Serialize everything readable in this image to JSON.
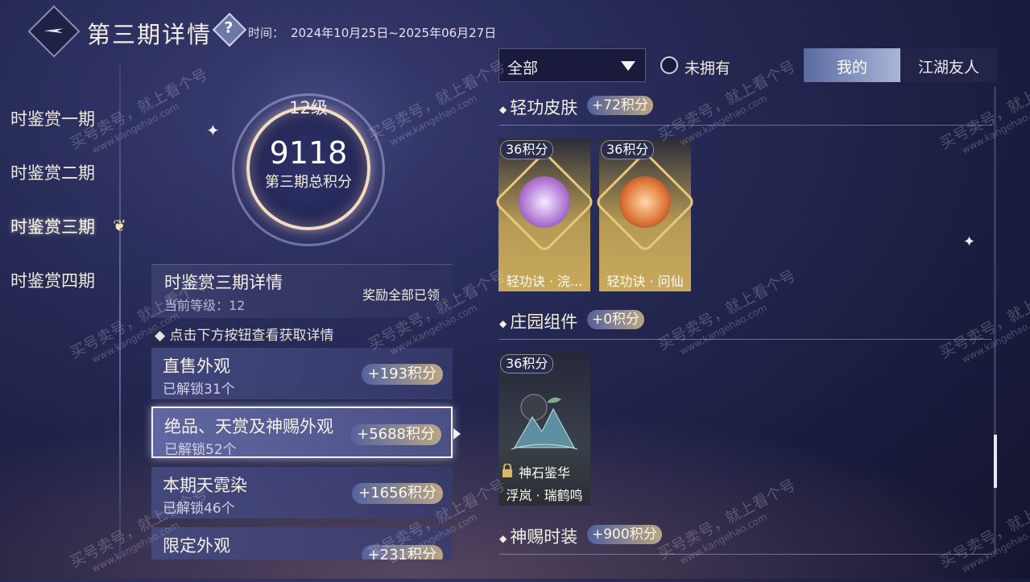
{
  "header": {
    "title": "第三期详情",
    "help_icon": "question-icon",
    "period_label": "时间：",
    "period_value": "2024年10月25日~2025年06月27日"
  },
  "nav": {
    "items": [
      {
        "label": "时鉴赏一期"
      },
      {
        "label": "时鉴赏二期"
      },
      {
        "label": "时鉴赏三期"
      },
      {
        "label": "时鉴赏四期"
      }
    ],
    "active_index": 2
  },
  "score": {
    "level": "12级",
    "value": "9118",
    "label": "第三期总积分"
  },
  "detail": {
    "title": "时鉴赏三期详情",
    "level_text": "当前等级：12",
    "reward_status": "奖励全部已领",
    "hint": "点击下方按钮查看获取详情"
  },
  "categories": [
    {
      "title": "直售外观",
      "count": "已解锁31个",
      "points": "+193积分"
    },
    {
      "title": "绝品、天赏及神赐外观",
      "count": "已解锁52个",
      "points": "+5688积分"
    },
    {
      "title": "本期天霓染",
      "count": "已解锁46个",
      "points": "+1656积分"
    },
    {
      "title": "限定外观",
      "count": "",
      "points": "+231积分"
    }
  ],
  "filter": {
    "dropdown_value": "全部",
    "unowned_label": "未拥有",
    "tab_mine": "我的",
    "tab_friends": "江湖友人"
  },
  "sections": [
    {
      "name": "轻功皮肤",
      "points": "+72积分",
      "items": [
        {
          "points": "36积分",
          "name": "轻功诀 · 浣..."
        },
        {
          "points": "36积分",
          "name": "轻功诀 · 问仙"
        }
      ]
    },
    {
      "name": "庄园组件",
      "points": "+0积分",
      "items": [
        {
          "points": "36积分",
          "subtitle": "神石鉴华",
          "name": "浮岚 · 瑞鹤鸣"
        }
      ]
    },
    {
      "name": "神赐时装",
      "points": "+900积分",
      "items": []
    }
  ],
  "watermark": {
    "text": "买号卖号，就上看个号",
    "site": "www.kangehao.com"
  },
  "colors": {
    "accent_gold": "#e8c878",
    "badge_gradient_start": "#53609c",
    "badge_gradient_end": "#b9a684",
    "background": "#1f2248"
  }
}
